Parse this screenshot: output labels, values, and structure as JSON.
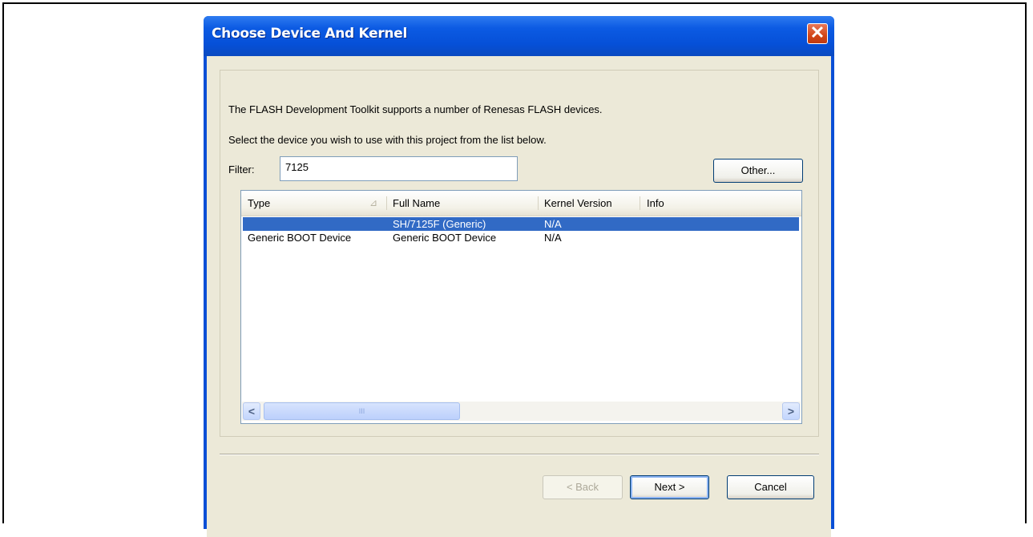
{
  "window": {
    "title": "Choose Device And Kernel",
    "close_glyph": "✕"
  },
  "intro": {
    "line1": "The FLASH Development Toolkit supports a number of Renesas FLASH devices.",
    "line2": "Select the device you wish to use with this project from the list below."
  },
  "filter": {
    "label": "Filter:",
    "value": "7125"
  },
  "buttons": {
    "other": "Other...",
    "back": "< Back",
    "next": "Next >",
    "cancel": "Cancel"
  },
  "list": {
    "columns": [
      "Type",
      "Full Name",
      "Kernel Version",
      "Info"
    ],
    "sort_glyph": "⊿",
    "rows": [
      {
        "type": "",
        "full_name": "SH/7125F (Generic)",
        "kernel_version": "N/A",
        "info": "",
        "selected": true
      },
      {
        "type": "Generic BOOT Device",
        "full_name": "Generic BOOT Device",
        "kernel_version": "N/A",
        "info": "",
        "selected": false
      }
    ]
  },
  "scrollbar": {
    "left_arrow": "<",
    "right_arrow": ">",
    "grip": "III"
  },
  "icons": [
    "close-icon",
    "sort-ascending-icon",
    "scroll-left-icon",
    "scroll-right-icon"
  ]
}
